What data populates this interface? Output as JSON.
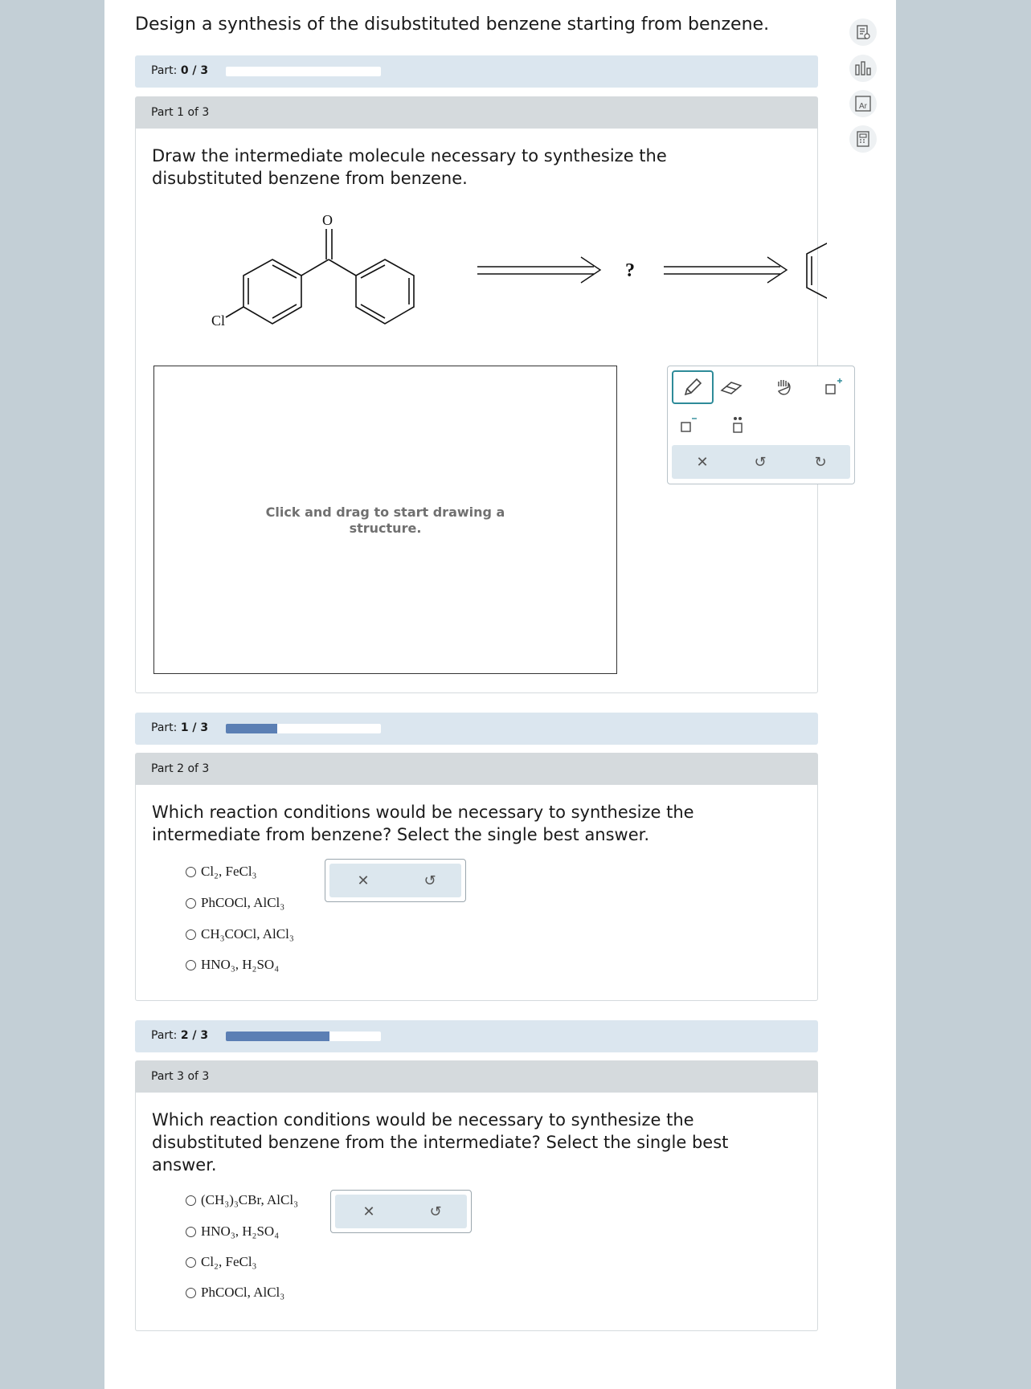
{
  "header": {
    "title": "Design a synthesis of the disubstituted benzene starting from benzene."
  },
  "progress": [
    {
      "label": "Part:",
      "value": "0 / 3",
      "fraction": 0.0
    },
    {
      "label": "Part:",
      "value": "1 / 3",
      "fraction": 0.333
    },
    {
      "label": "Part:",
      "value": "2 / 3",
      "fraction": 0.667
    }
  ],
  "parts": [
    {
      "header": "Part 1 of 3",
      "question_lines": [
        "Draw the intermediate molecule necessary to synthesize the",
        "disubstituted benzene from benzene."
      ],
      "scheme": {
        "unknown": "?",
        "oxygen_label": "O",
        "chlorine_label": "Cl"
      },
      "canvas_hint_lines": [
        "Click and drag to start drawing a",
        "structure."
      ],
      "tools": [
        "pencil-icon",
        "eraser-icon",
        "hand-icon",
        "add-charge-icon",
        "negative-charge-icon",
        "lone-pair-icon"
      ],
      "actions": [
        "close-icon",
        "undo-icon",
        "redo-icon"
      ]
    },
    {
      "header": "Part 2 of 3",
      "question_lines": [
        "Which reaction conditions would be necessary to synthesize the",
        "intermediate from benzene? Select the single best answer."
      ],
      "options": [
        "Cl₂, FeCl₃",
        "PhCOCl, AlCl₃",
        "CH₃COCl, AlCl₃",
        "HNO₃, H₂SO₄"
      ],
      "actions": [
        "close-icon",
        "undo-icon"
      ]
    },
    {
      "header": "Part 3 of 3",
      "question_lines": [
        "Which reaction conditions would be necessary to synthesize the",
        "disubstituted benzene from the intermediate? Select the single best",
        "answer."
      ],
      "options": [
        "(CH₃)₃CBr, AlCl₃",
        "HNO₃, H₂SO₄",
        "Cl₂, FeCl₃",
        "PhCOCl, AlCl₃"
      ],
      "actions": [
        "close-icon",
        "undo-icon"
      ]
    }
  ],
  "sidebar": [
    "notes-icon",
    "bar-chart-icon",
    "periodic-table-icon",
    "calculator-icon"
  ],
  "colors": {
    "progress_fill": "#5b7fb4",
    "progress_bg": "#dbe6ef",
    "part_header": "#d5dadd",
    "accent": "#2e8b99",
    "background": "#c3cfd6"
  }
}
